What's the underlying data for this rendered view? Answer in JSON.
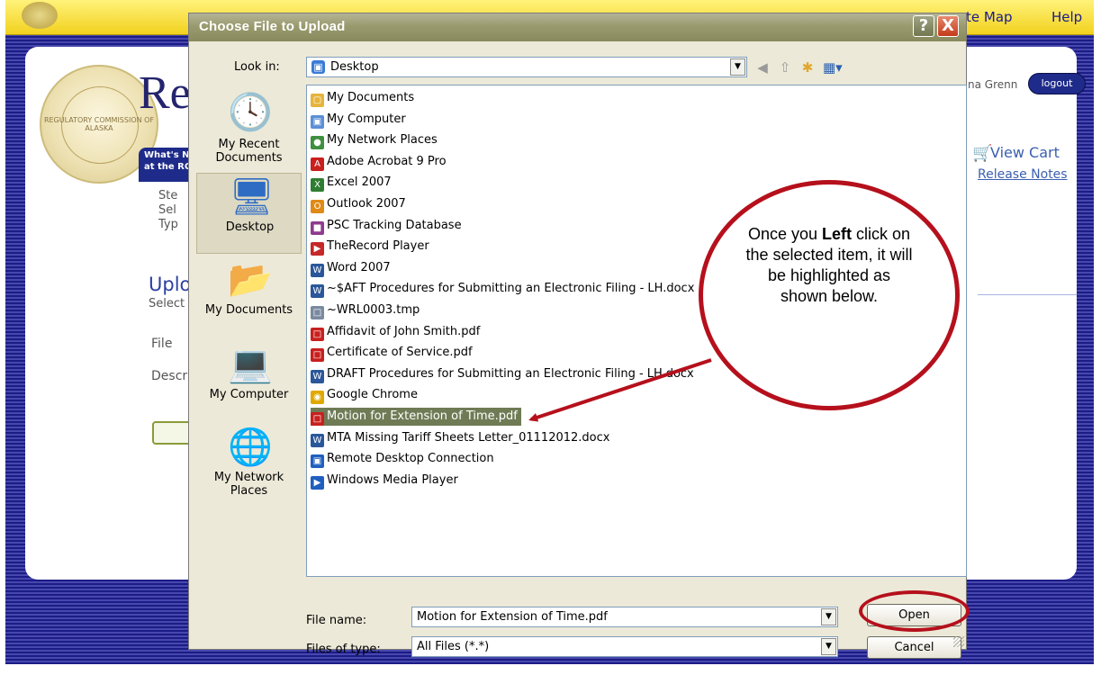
{
  "background_page": {
    "nav": {
      "site_map": "te Map",
      "help": "Help"
    },
    "title": "Re",
    "user_name": "na Grenn",
    "logout": "logout",
    "whats_new": [
      "What's N",
      "at the RC"
    ],
    "steps": [
      "Ste",
      "Sel",
      "Typ"
    ],
    "upload_heading": "Uplo",
    "select_line": "Select",
    "file_label": "File",
    "description_label": "Descri",
    "view_cart": "View Cart",
    "release_notes": "Release Notes",
    "seal_text": "REGULATORY COMMISSION OF ALASKA"
  },
  "dialog": {
    "title": "Choose File to Upload",
    "help_button": "?",
    "close_button": "X",
    "look_in_label": "Look in:",
    "look_in_value": "Desktop",
    "places": [
      {
        "label": "My Recent Documents",
        "icon": "recent-documents-icon"
      },
      {
        "label": "Desktop",
        "icon": "desktop-icon"
      },
      {
        "label": "My Documents",
        "icon": "my-documents-folder-icon"
      },
      {
        "label": "My Computer",
        "icon": "computer-icon"
      },
      {
        "label": "My Network Places",
        "icon": "network-globe-icon"
      }
    ],
    "files": [
      {
        "name": "My Documents",
        "icon": "folder-icon",
        "color": "#e6b43c"
      },
      {
        "name": "My Computer",
        "icon": "computer-icon",
        "color": "#5b8fd6"
      },
      {
        "name": "My Network Places",
        "icon": "network-icon",
        "color": "#3f8f3f"
      },
      {
        "name": "Adobe Acrobat 9 Pro",
        "icon": "acrobat-shortcut-icon",
        "color": "#c8201e"
      },
      {
        "name": "Excel 2007",
        "icon": "excel-icon",
        "color": "#2e7d32"
      },
      {
        "name": "Outlook 2007",
        "icon": "outlook-icon",
        "color": "#e08a16"
      },
      {
        "name": "PSC Tracking Database",
        "icon": "database-icon",
        "color": "#8e3b8e"
      },
      {
        "name": "TheRecord Player",
        "icon": "player-icon",
        "color": "#c62828"
      },
      {
        "name": "Word 2007",
        "icon": "word-icon",
        "color": "#2b579a"
      },
      {
        "name": "~$AFT Procedures for Submitting an Electronic Filing - LH.docx",
        "icon": "word-doc-icon",
        "color": "#2b579a"
      },
      {
        "name": "~WRL0003.tmp",
        "icon": "tmp-file-icon",
        "color": "#7a8aa0"
      },
      {
        "name": "Affidavit of John Smith.pdf",
        "icon": "pdf-icon",
        "color": "#c8201e"
      },
      {
        "name": "Certificate of Service.pdf",
        "icon": "pdf-icon",
        "color": "#c8201e"
      },
      {
        "name": "DRAFT Procedures for Submitting an Electronic Filing - LH.docx",
        "icon": "word-doc-icon",
        "color": "#2b579a"
      },
      {
        "name": "Google Chrome",
        "icon": "chrome-icon",
        "color": "#e0a800"
      },
      {
        "name": "Motion for Extension of Time.pdf",
        "icon": "pdf-icon",
        "color": "#c8201e",
        "selected": true
      },
      {
        "name": "MTA Missing Tariff Sheets Letter_01112012.docx",
        "icon": "word-doc-icon",
        "color": "#2b579a"
      },
      {
        "name": "Remote Desktop Connection",
        "icon": "remote-desktop-icon",
        "color": "#1f5fbf"
      },
      {
        "name": "Windows Media Player",
        "icon": "media-player-icon",
        "color": "#1f5fbf"
      }
    ],
    "file_name_label": "File name:",
    "file_name_value": "Motion for Extension of Time.pdf",
    "files_of_type_label": "Files of type:",
    "files_of_type_value": "All Files (*.*)",
    "open_button": "Open",
    "cancel_button": "Cancel"
  },
  "annotation": {
    "callout_prefix": "Once you ",
    "callout_bold": "Left",
    "callout_suffix": " click on the selected item, it will be highlighted as shown below.",
    "accent_color": "#b5101c"
  }
}
